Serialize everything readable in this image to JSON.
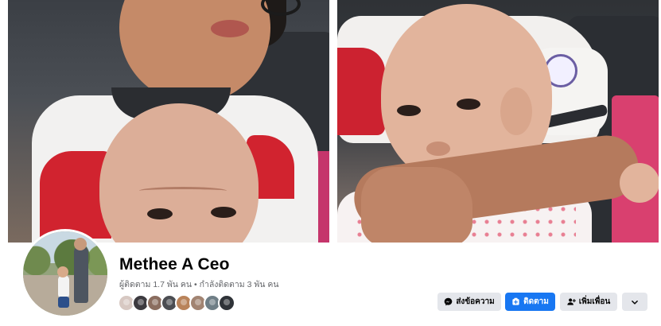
{
  "profile": {
    "name": "Methee A Ceo",
    "followers_text": "ผู้ติดตาม 1.7 พัน คน",
    "separator": "•",
    "following_text": "กำลังติดตาม 3 พัน คน"
  },
  "follower_avatars": [
    {
      "color": "#d7c8c2"
    },
    {
      "color": "#3c3a3f"
    },
    {
      "color": "#8a6d5f"
    },
    {
      "color": "#4b4d52"
    },
    {
      "color": "#b9835a"
    },
    {
      "color": "#a28472"
    },
    {
      "color": "#6f7e86"
    },
    {
      "color": "#2f3338"
    }
  ],
  "actions": {
    "message_label": "ส่งข้อความ",
    "follow_label": "ติดตาม",
    "add_friend_label": "เพิ่มเพื่อน",
    "more_icon": "chevron-down-icon"
  },
  "colors": {
    "accent": "#1877f2",
    "button_gray": "#e4e6eb",
    "text_primary": "#050505",
    "text_secondary": "#65676b"
  }
}
